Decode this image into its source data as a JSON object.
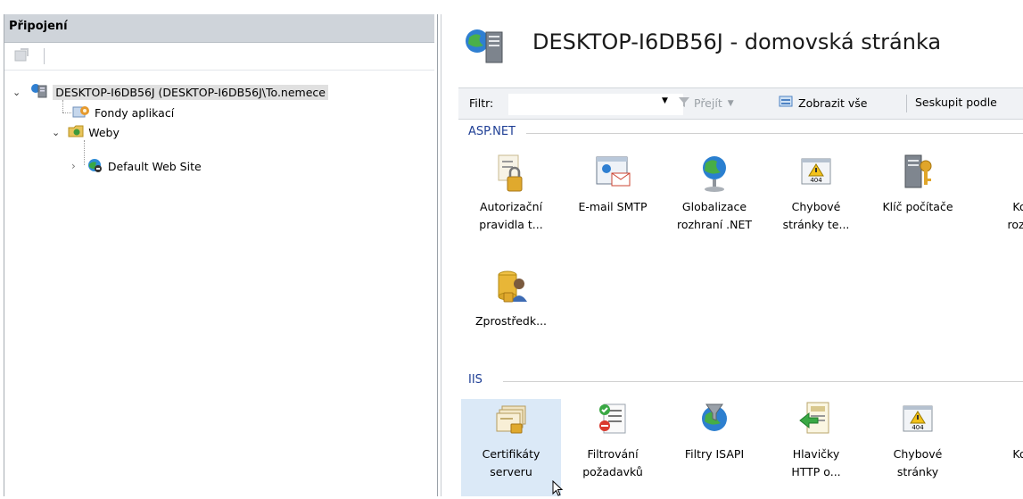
{
  "connections": {
    "title": "Připojení",
    "tree": [
      {
        "label": "DESKTOP-I6DB56J (DESKTOP-I6DB56J\\To.nemece",
        "icon": "server-icon",
        "expanded": true
      },
      {
        "label": "Fondy aplikací",
        "icon": "app-pool-icon"
      },
      {
        "label": "Weby",
        "icon": "sites-folder-icon",
        "expanded": true
      },
      {
        "label": "Default Web Site",
        "icon": "website-icon",
        "expanded": false
      }
    ]
  },
  "main": {
    "title": "DESKTOP-I6DB56J - domovská stránka",
    "filter": {
      "label": "Filtr:",
      "value": "",
      "go_label": "Přejít",
      "show_all_label": "Zobrazit vše",
      "group_by_label": "Seskupit podle"
    },
    "groups": [
      {
        "name": "ASP.NET",
        "features": [
          {
            "label1": "Autorizační",
            "label2": "pravidla t...",
            "icon": "authorization-rules-icon"
          },
          {
            "label1": "E-mail SMTP",
            "label2": "",
            "icon": "smtp-email-icon"
          },
          {
            "label1": "Globalizace",
            "label2": "rozhraní .NET",
            "icon": "globalization-icon"
          },
          {
            "label1": "Chybové",
            "label2": "stránky te...",
            "icon": "error-pages-icon"
          },
          {
            "label1": "Klíč počítače",
            "label2": "",
            "icon": "machine-key-icon"
          },
          {
            "label1": "Ko",
            "label2": "rozh",
            "icon": "config-icon"
          },
          {
            "label1": "Zprostředk...",
            "label2": "",
            "icon": "providers-icon"
          }
        ]
      },
      {
        "name": "IIS",
        "features": [
          {
            "label1": "Certifikáty",
            "label2": "serveru",
            "icon": "server-certificates-icon"
          },
          {
            "label1": "Filtrování",
            "label2": "požadavků",
            "icon": "request-filtering-icon"
          },
          {
            "label1": "Filtry ISAPI",
            "label2": "",
            "icon": "isapi-filters-icon"
          },
          {
            "label1": "Hlavičky",
            "label2": "HTTP o...",
            "icon": "http-headers-icon"
          },
          {
            "label1": "Chybové",
            "label2": "stránky",
            "icon": "error-pages-icon"
          },
          {
            "label1": "Ko",
            "label2": "",
            "icon": "compression-icon"
          }
        ]
      }
    ]
  }
}
